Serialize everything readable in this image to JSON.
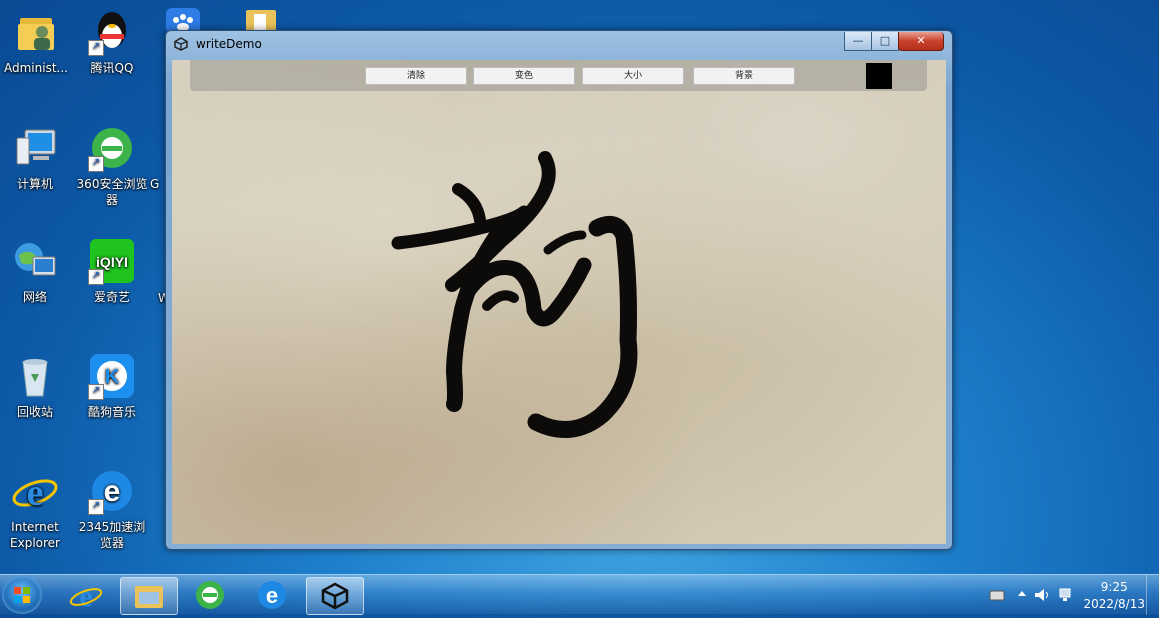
{
  "desktop": {
    "icons": [
      {
        "label": "Administ..."
      },
      {
        "label": "腾讯QQ"
      },
      {
        "label": "计算机"
      },
      {
        "label": "360安全浏览器"
      },
      {
        "label": "网络"
      },
      {
        "label": "爱奇艺"
      },
      {
        "label": "回收站"
      },
      {
        "label": "酷狗音乐"
      },
      {
        "label": "Internet Explorer"
      },
      {
        "label": "2345加速浏览器"
      }
    ],
    "partial_labels": [
      "G",
      "W"
    ]
  },
  "window": {
    "title": "writeDemo",
    "controls": {
      "minimize": "—",
      "maximize": "□",
      "close": "✕"
    },
    "toolbar": {
      "clear": "清除",
      "color": "变色",
      "size": "大小",
      "background": "背景"
    },
    "current_color": "#000000"
  },
  "taskbar": {
    "clock": {
      "time": "9:25",
      "date": "2022/8/13"
    }
  }
}
